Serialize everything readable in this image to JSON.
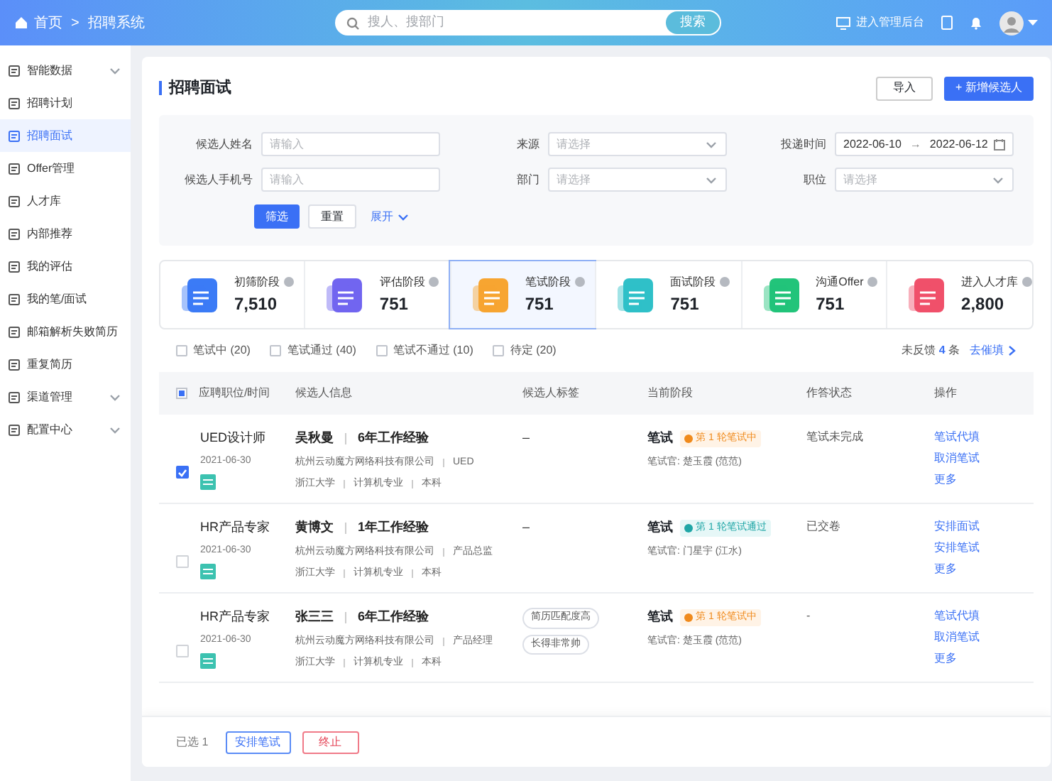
{
  "header": {
    "breadcrumb": [
      "首页",
      "招聘系统"
    ],
    "separator": ">",
    "search": {
      "placeholder": "搜人、搜部门",
      "button": "搜索"
    },
    "admin_link": "进入管理后台"
  },
  "sidebar": {
    "items": [
      {
        "label": "智能数据",
        "selected": false,
        "expandable": true
      },
      {
        "label": "招聘计划",
        "selected": false,
        "expandable": false
      },
      {
        "label": "招聘面试",
        "selected": true,
        "expandable": false
      },
      {
        "label": "Offer管理",
        "selected": false,
        "expandable": false
      },
      {
        "label": "人才库",
        "selected": false,
        "expandable": false
      },
      {
        "label": "内部推荐",
        "selected": false,
        "expandable": false
      },
      {
        "label": "我的评估",
        "selected": false,
        "expandable": false
      },
      {
        "label": "我的笔/面试",
        "selected": false,
        "expandable": false
      },
      {
        "label": "邮箱解析失败简历",
        "selected": false,
        "expandable": false
      },
      {
        "label": "重复简历",
        "selected": false,
        "expandable": false
      },
      {
        "label": "渠道管理",
        "selected": false,
        "expandable": true
      },
      {
        "label": "配置中心",
        "selected": false,
        "expandable": true
      }
    ]
  },
  "page": {
    "title": "招聘面试",
    "import_button": "导入",
    "add_button": "+ 新增候选人"
  },
  "filters": {
    "fields": [
      {
        "label": "候选人姓名",
        "kind": "input",
        "placeholder": "请输入"
      },
      {
        "label": "来源",
        "kind": "select",
        "placeholder": "请选择"
      },
      {
        "label": "投递时间",
        "kind": "daterange",
        "start": "2022-06-10",
        "arrow": "→",
        "end": "2022-06-12"
      },
      {
        "label": "候选人手机号",
        "kind": "input",
        "placeholder": "请输入"
      },
      {
        "label": "部门",
        "kind": "select",
        "placeholder": "请选择"
      },
      {
        "label": "职位",
        "kind": "select",
        "placeholder": "请选择"
      }
    ],
    "filter_button": "筛选",
    "reset_button": "重置",
    "expand_link": "展开"
  },
  "stages": [
    {
      "label": "初筛阶段",
      "count": "7,510",
      "selected": false,
      "color": "#3b7bf6"
    },
    {
      "label": "评估阶段",
      "count": "751",
      "selected": false,
      "color": "#7165f0"
    },
    {
      "label": "笔试阶段",
      "count": "751",
      "selected": true,
      "color": "#f7a531"
    },
    {
      "label": "面试阶段",
      "count": "751",
      "selected": false,
      "color": "#2fc0c8"
    },
    {
      "label": "沟通Offer",
      "count": "751",
      "selected": false,
      "color": "#22c47a"
    },
    {
      "label": "进入人才库",
      "count": "2,800",
      "selected": false,
      "color": "#f0506a"
    }
  ],
  "status_filters": [
    {
      "label": "笔试中 (20)",
      "checked": false
    },
    {
      "label": "笔试通过 (40)",
      "checked": false
    },
    {
      "label": "笔试不通过 (10)",
      "checked": false
    },
    {
      "label": "待定 (20)",
      "checked": false
    }
  ],
  "feedback": {
    "prefix": "未反馈",
    "count": "4",
    "suffix": "条",
    "link": "去催填"
  },
  "table": {
    "select_all_indeterminate": true,
    "columns": [
      "应聘职位/时间",
      "候选人信息",
      "候选人标签",
      "当前阶段",
      "作答状态",
      "操作"
    ],
    "rows": [
      {
        "selected": true,
        "position": "UED设计师",
        "date": "2021-06-30",
        "name": "吴秋曼",
        "experience": "6年工作经验",
        "company": "杭州云动魔方网络科技有限公司",
        "role": "UED",
        "school": "浙江大学",
        "major": "计算机专业",
        "degree": "本科",
        "tags": [],
        "tags_empty": "–",
        "stage": "笔试",
        "badge": {
          "kind": "ongoing",
          "text": "第 1 轮笔试中"
        },
        "examiner": "笔试官: 楚玉霞 (范范)",
        "status": "笔试未完成",
        "actions": [
          "笔试代填",
          "取消笔试",
          "更多"
        ]
      },
      {
        "selected": false,
        "position": "HR产品专家",
        "date": "2021-06-30",
        "name": "黄博文",
        "experience": "1年工作经验",
        "company": "杭州云动魔方网络科技有限公司",
        "role": "产品总监",
        "school": "浙江大学",
        "major": "计算机专业",
        "degree": "本科",
        "tags": [],
        "tags_empty": "–",
        "stage": "笔试",
        "badge": {
          "kind": "passed",
          "text": "第 1 轮笔试通过"
        },
        "examiner": "笔试官: 门星宇 (江水)",
        "status": "已交卷",
        "actions": [
          "安排面试",
          "安排笔试",
          "更多"
        ]
      },
      {
        "selected": false,
        "position": "HR产品专家",
        "date": "2021-06-30",
        "name": "张三三",
        "experience": "6年工作经验",
        "company": "杭州云动魔方网络科技有限公司",
        "role": "产品经理",
        "school": "浙江大学",
        "major": "计算机专业",
        "degree": "本科",
        "tags": [
          "简历匹配度高",
          "长得非常帅"
        ],
        "stage": "笔试",
        "badge": {
          "kind": "ongoing",
          "text": "第 1 轮笔试中"
        },
        "examiner": "笔试官: 楚玉霞 (范范)",
        "status": "-",
        "actions": [
          "笔试代填",
          "取消笔试",
          "更多"
        ]
      }
    ]
  },
  "footer": {
    "selected_count": "已选 1",
    "arrange_button": "安排笔试",
    "stop_button": "终止"
  }
}
